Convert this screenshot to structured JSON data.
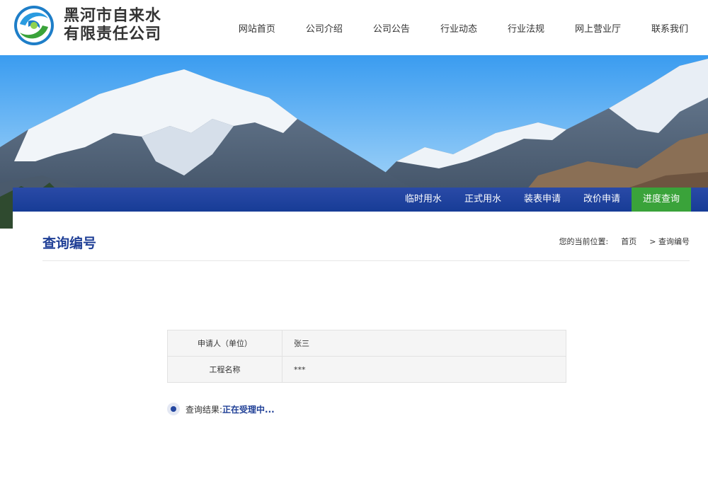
{
  "header": {
    "company_name_line1": "黑河市自来水",
    "company_name_line2": "有限责任公司",
    "logo_icon": "water-drop-logo-icon",
    "nav": [
      "网站首页",
      "公司介绍",
      "公司公告",
      "行业动态",
      "行业法规",
      "网上营业厅",
      "联系我们"
    ]
  },
  "subnav": {
    "items": [
      "临时用水",
      "正式用水",
      "装表申请",
      "改价申请",
      "进度查询"
    ],
    "active_index": 4
  },
  "page": {
    "title": "查询编号",
    "breadcrumb_prefix": "您的当前位置:",
    "breadcrumb_home": "首页",
    "breadcrumb_current": "> 查询编号"
  },
  "table": {
    "rows": [
      {
        "label": "申请人（单位）",
        "value": "张三"
      },
      {
        "label": "工程名称",
        "value": "***"
      }
    ]
  },
  "result": {
    "label": "查询结果:",
    "value": "正在受理中..."
  },
  "colors": {
    "brand_blue": "#1f3f96",
    "subnav_blue": "#1f43a0",
    "active_green": "#3aa33a"
  }
}
